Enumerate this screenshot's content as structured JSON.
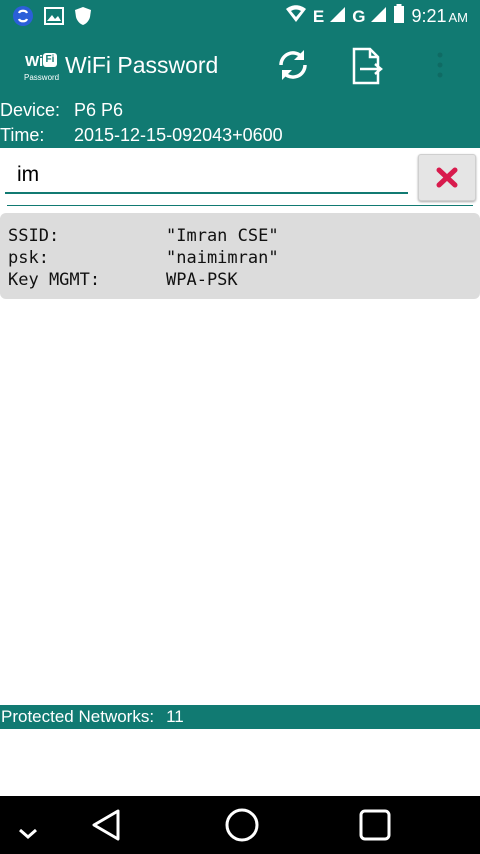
{
  "status_bar": {
    "network_label_1": "E",
    "network_label_2": "G",
    "time": "9:21",
    "ampm": "AM",
    "icons": [
      "sync-app-icon",
      "image-icon",
      "shield-icon",
      "wifi-icon",
      "signal-icon",
      "signal-icon",
      "battery-icon"
    ]
  },
  "app_bar": {
    "logo_wi": "Wi",
    "logo_fi": "Fi",
    "logo_password": "Password",
    "title": "WiFi Password",
    "actions": [
      "refresh-icon",
      "export-file-icon",
      "overflow-menu-icon"
    ]
  },
  "device_info": {
    "device_label": "Device:",
    "device_value": "P6 P6",
    "time_label": "Time:",
    "time_value": "2015-12-15-092043+0600"
  },
  "search": {
    "value": "im",
    "clear_icon": "close-x-icon"
  },
  "networks": [
    {
      "ssid_label": "SSID:",
      "ssid": "\"Imran CSE\"",
      "psk_label": "psk:",
      "psk": "\"naimimran\"",
      "key_mgmt_label": "Key MGMT:",
      "key_mgmt": "WPA-PSK"
    }
  ],
  "footer": {
    "label": "Protected Networks:",
    "count": "11"
  },
  "nav_bar": {
    "buttons": [
      "hide-keyboard-icon",
      "back-icon",
      "home-icon",
      "recent-apps-icon"
    ]
  },
  "colors": {
    "primary": "#117a72",
    "accent_clear": "#d81b4d",
    "card": "#dcdcdc"
  }
}
